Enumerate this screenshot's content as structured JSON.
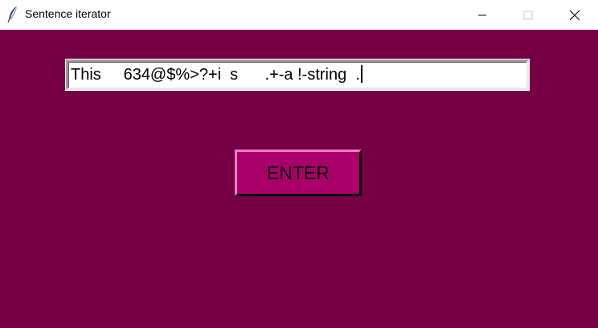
{
  "window": {
    "title": "Sentence iterator",
    "app_icon": "feather-icon",
    "controls": {
      "minimize": "minimize-icon",
      "maximize": "maximize-icon",
      "close": "close-icon"
    }
  },
  "form": {
    "entry_value": "This     634@$%>?+i  s      .+-a !-string  .",
    "enter_label": "ENTER"
  },
  "colors": {
    "background": "#750044",
    "button": "#a9006a"
  }
}
